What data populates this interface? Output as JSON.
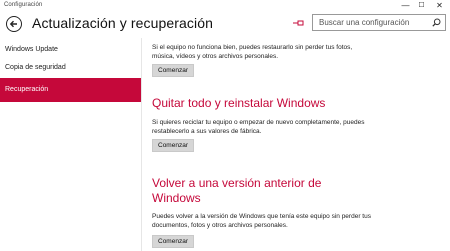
{
  "window": {
    "title": "Configuración",
    "minimize": "—",
    "maximize": "☐",
    "close": "✕"
  },
  "header": {
    "title": "Actualización y recuperación",
    "search_placeholder": "Buscar una configuración"
  },
  "sidebar": {
    "items": [
      {
        "label": "Windows Update",
        "active": false
      },
      {
        "label": "Copia de seguridad",
        "active": false
      },
      {
        "label": "Recuperación",
        "active": true
      }
    ]
  },
  "content": {
    "section1": {
      "desc": "Si el equipo no funciona bien, puedes restaurarlo sin perder tus fotos, música, vídeos y otros archivos personales.",
      "button": "Comenzar"
    },
    "section2": {
      "heading": "Quitar todo y reinstalar Windows",
      "desc": "Si quieres reciclar tu equipo o empezar de nuevo completamente, puedes restablecerlo a sus valores de fábrica.",
      "button": "Comenzar"
    },
    "section3": {
      "heading": "Volver a una versión anterior de Windows",
      "desc": "Puedes volver a la versión de Windows que tenía este equipo sin perder tus documentos, fotos y otros archivos personales.",
      "button": "Comenzar"
    }
  },
  "colors": {
    "accent": "#c5083a"
  }
}
